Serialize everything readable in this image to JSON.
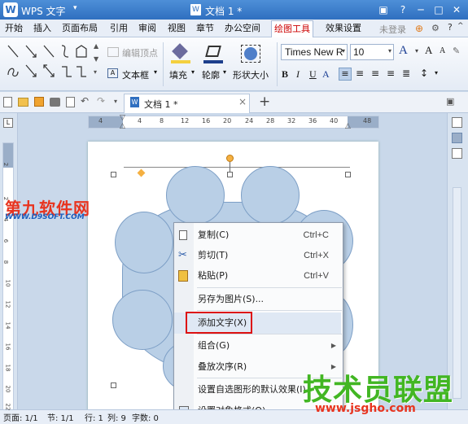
{
  "app": {
    "logo": "W",
    "name": "WPS 文字",
    "caret": "▾",
    "doc_title": "文档 1 *"
  },
  "menu": {
    "items": [
      "开始",
      "插入",
      "页面布局",
      "引用",
      "审阅",
      "视图",
      "章节",
      "办公空间",
      "绘图工具",
      "效果设置"
    ],
    "active": "绘图工具",
    "login": "未登录"
  },
  "ribbon": {
    "edit_vertex": "编辑顶点",
    "textbox": "文本框",
    "fill": "填充",
    "outline": "轮廓",
    "shape_size": "形状大小",
    "font": "Times New R",
    "size": "10"
  },
  "tab": {
    "label": "文档 1 *",
    "add": "+"
  },
  "ruler": {
    "ticks": [
      "4",
      "4",
      "8",
      "12",
      "16",
      "20",
      "24",
      "28",
      "32",
      "36",
      "40",
      "48"
    ]
  },
  "vruler": {
    "ticks": [
      "2",
      "2",
      "4",
      "6",
      "8",
      "10",
      "12",
      "14",
      "16",
      "18",
      "20",
      "22",
      "24"
    ]
  },
  "context_menu": {
    "items": [
      {
        "label": "复制(C)",
        "shortcut": "Ctrl+C",
        "icon": "copy-icon"
      },
      {
        "label": "剪切(T)",
        "shortcut": "Ctrl+X",
        "icon": "cut-icon"
      },
      {
        "label": "粘贴(P)",
        "shortcut": "Ctrl+V",
        "icon": "paste-icon"
      },
      {
        "label": "另存为图片(S)...",
        "shortcut": "",
        "icon": ""
      },
      {
        "label": "添加文字(X)",
        "shortcut": "",
        "icon": ""
      },
      {
        "label": "组合(G)",
        "shortcut": "",
        "icon": ""
      },
      {
        "label": "叠放次序(R)",
        "shortcut": "",
        "icon": ""
      },
      {
        "label": "设置自选图形的默认效果(I)",
        "shortcut": "",
        "icon": ""
      },
      {
        "label": "设置对象格式(O)...",
        "shortcut": "",
        "icon": "format-icon"
      }
    ]
  },
  "status": {
    "page": "页面: 1/1",
    "section": "节: 1/1",
    "row": "行: 1",
    "col": "列: 9",
    "words": "字数: 0"
  },
  "watermarks": {
    "left_title": "第九软件网",
    "left_url": "WWW.D9SOFT.COM",
    "right_title": "技术员联盟",
    "right_url": "www.jsgho.com"
  },
  "colors": {
    "title_bar": "#2f6fc0",
    "shape_fill": "#b9cfe6",
    "shape_border": "#7d9fc6",
    "highlight": "#dd1111",
    "active_menu": "#cc0000"
  }
}
